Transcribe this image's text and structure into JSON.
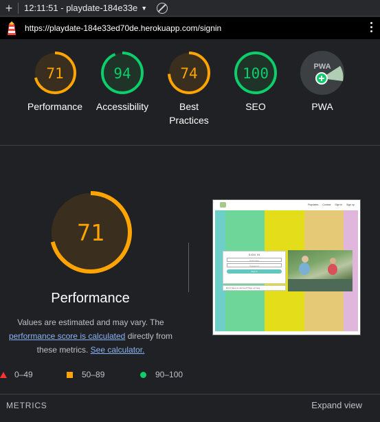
{
  "toolbar": {
    "new_label": "+",
    "session": "12:11:51 - playdate-184e33e"
  },
  "url": "https://playdate-184e33ed70de.herokuapp.com/signin",
  "categories": [
    {
      "score": "71",
      "label": "Performance",
      "value": 71,
      "color": "#ffa400",
      "fill": "#3a2f1e"
    },
    {
      "score": "94",
      "label": "Accessibility",
      "value": 94,
      "color": "#0cce6b",
      "fill": "#1f3328"
    },
    {
      "score": "74",
      "label": "Best Practices",
      "value": 74,
      "color": "#ffa400",
      "fill": "#3a2f1e"
    },
    {
      "score": "100",
      "label": "SEO",
      "value": 100,
      "color": "#0cce6b",
      "fill": "#1f3328"
    },
    {
      "score": "PWA",
      "label": "PWA",
      "icon": "pwa-badge-icon"
    }
  ],
  "performance": {
    "score": "71",
    "value": 71,
    "title": "Performance",
    "note_1": "Values are estimated and may vary. The",
    "link_1": "performance score is calculated",
    "note_2": " directly from",
    "note_3": "these metrics. ",
    "link_2": "See calculator."
  },
  "legend": {
    "fail": "0–49",
    "average": "50–89",
    "pass": "90–100"
  },
  "thumbnail": {
    "nav_links": [
      "Playdates",
      "Contact",
      "Sign in",
      "Sign up"
    ],
    "card_title": "SIGN IN",
    "field_1": "Username",
    "field_2": "Password",
    "button": "Sign in",
    "signup_text": "Don't have an account? Sign up here"
  },
  "metrics": {
    "heading": "METRICS",
    "expand": "Expand view"
  },
  "colors": {
    "pass": "#0cce6b",
    "average": "#ffa400",
    "fail": "#ff3333",
    "link": "#8ab4f8"
  }
}
